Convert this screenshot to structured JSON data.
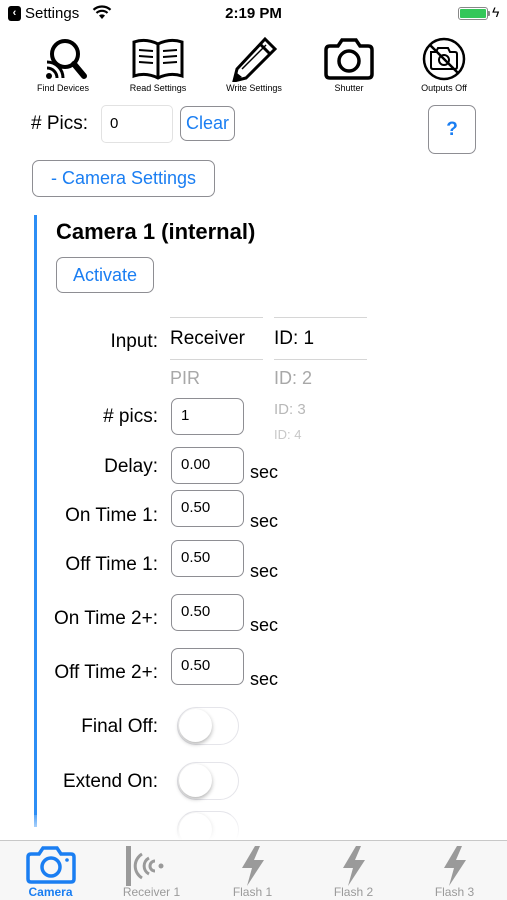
{
  "status_bar": {
    "back_app": "Settings",
    "time": "2:19 PM"
  },
  "toolbar": [
    {
      "label": "Find Devices",
      "icon": "find-devices-icon"
    },
    {
      "label": "Read Settings",
      "icon": "book-icon"
    },
    {
      "label": "Write Settings",
      "icon": "pencil-icon"
    },
    {
      "label": "Shutter",
      "icon": "camera-icon"
    },
    {
      "label": "Outputs Off",
      "icon": "camera-off-icon"
    }
  ],
  "pics": {
    "label": "# Pics:",
    "value": "0",
    "clear_label": "Clear",
    "help_label": "?"
  },
  "camera_settings_button": "- Camera Settings",
  "camera": {
    "title": "Camera 1 (internal)",
    "activate_label": "Activate",
    "input_label": "Input:",
    "input_options": [
      "Receiver",
      "PIR"
    ],
    "id_options": [
      "ID: 1",
      "ID: 2",
      "ID: 3",
      "ID: 4"
    ],
    "rows": [
      {
        "label": "# pics:",
        "value": "1",
        "unit": ""
      },
      {
        "label": "Delay:",
        "value": "0.00",
        "unit": "sec"
      },
      {
        "label": "On Time 1:",
        "value": "0.50",
        "unit": "sec"
      },
      {
        "label": "Off Time 1:",
        "value": "0.50",
        "unit": "sec"
      },
      {
        "label": "On Time 2+:",
        "value": "0.50",
        "unit": "sec"
      },
      {
        "label": "Off Time 2+:",
        "value": "0.50",
        "unit": "sec"
      }
    ],
    "toggles": [
      {
        "label": "Final Off:",
        "on": false
      },
      {
        "label": "Extend On:",
        "on": false
      }
    ]
  },
  "tabs": [
    {
      "label": "Camera",
      "icon": "camera-icon",
      "active": true
    },
    {
      "label": "Receiver 1",
      "icon": "receiver-icon",
      "active": false
    },
    {
      "label": "Flash 1",
      "icon": "flash-icon",
      "active": false
    },
    {
      "label": "Flash 2",
      "icon": "flash-icon",
      "active": false
    },
    {
      "label": "Flash 3",
      "icon": "flash-icon",
      "active": false
    }
  ],
  "colors": {
    "accent": "#1a7ef2",
    "panel_bar": "#2d8ef5",
    "battery": "#34c759"
  }
}
